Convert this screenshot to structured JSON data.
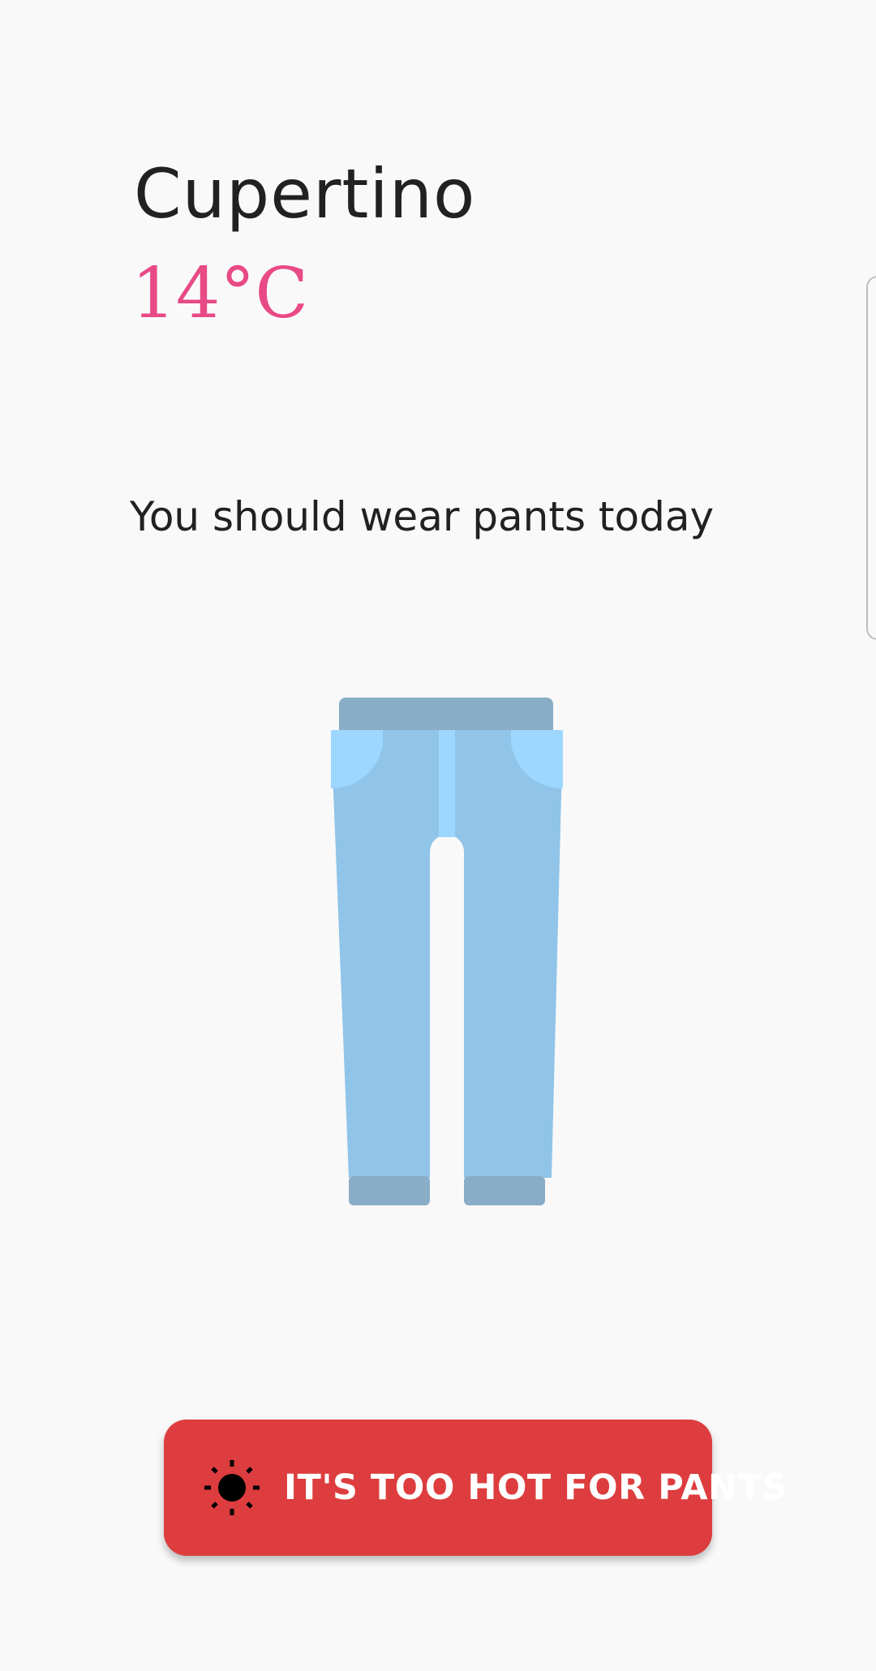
{
  "location": {
    "city": "Cupertino",
    "temperature": "14°C"
  },
  "recommendation": {
    "text": "You should wear pants today",
    "image": "pants-illustration"
  },
  "action_button": {
    "label": "IT'S TOO HOT FOR PANTS",
    "icon": "sun-icon"
  },
  "colors": {
    "temperature": "#e84a86",
    "button_background": "#dd3d3e",
    "pants_main": "#90c4e8",
    "pants_dark": "#89adc6",
    "pants_light": "#9dd7ff",
    "background": "#f9f9fa"
  }
}
